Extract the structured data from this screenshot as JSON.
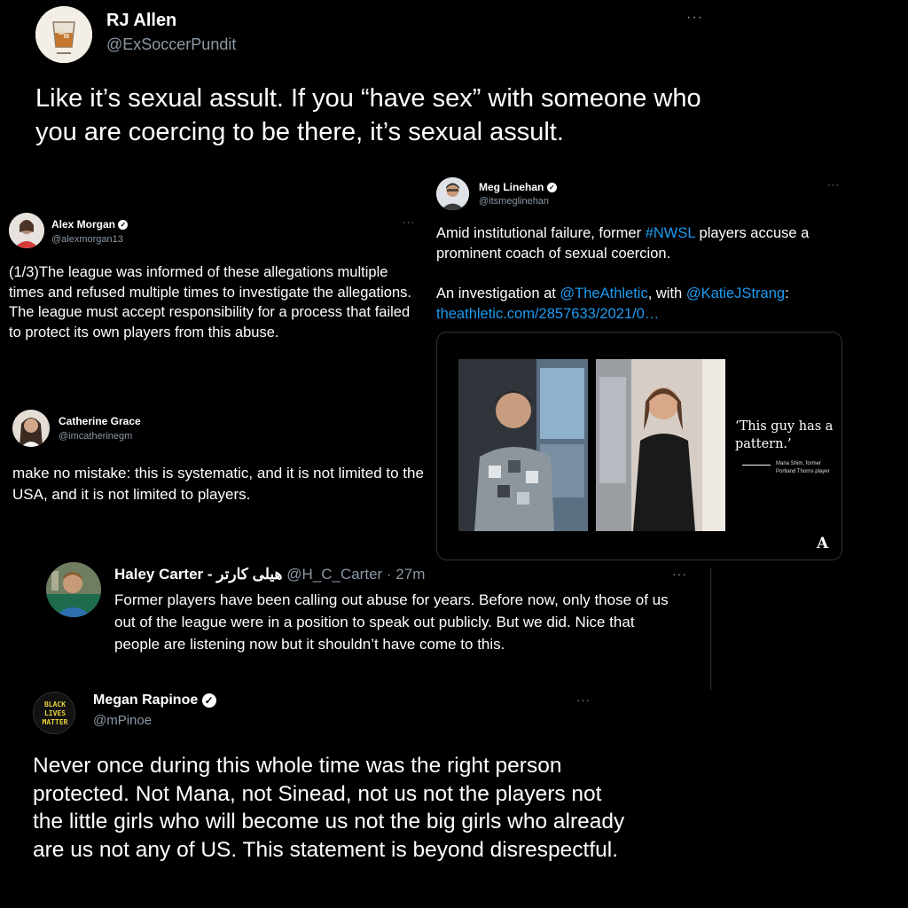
{
  "tweets": [
    {
      "name": "RJ Allen",
      "handle": "@ExSoccerPundit",
      "text": "Like it’s sexual assult. If you “have sex” with someone who you are coercing to be there, it’s sexual assult."
    },
    {
      "name": "Alex Morgan",
      "handle": "@alexmorgan13",
      "verified": true,
      "text": "(1/3)The league was informed of these allegations multiple times and refused multiple times to investigate the allegations. The league must accept responsibility for a process that failed to protect its own players from this abuse."
    },
    {
      "name": "Meg Linehan",
      "handle": "@itsmeglinehan",
      "verified": true,
      "text_1": "Amid institutional failure, former ",
      "hashtag": "#NWSL",
      "text_2": " players accuse a prominent coach of sexual coercion.",
      "text_3": "An investigation at ",
      "mention_1": "@TheAthletic",
      "text_4": ", with ",
      "mention_2": "@KatieJStrang",
      "text_5": ":",
      "link": "theathletic.com/2857633/2021/0…",
      "card": {
        "quote": "‘This guy has a pattern.’",
        "credit": "Mana Shim, former Portland Thorns player",
        "logo": "A"
      }
    },
    {
      "name": "Catherine Grace",
      "handle": "@imcatherinegm",
      "text": "make no mistake: this is systematic, and it is not limited to the USA, and it is not limited to players."
    },
    {
      "name": "Haley Carter - هيلى كارتر",
      "handle": "@H_C_Carter",
      "time": "· 27m",
      "text": "Former players have been calling out abuse for years. Before now, only those of us out of the league were in a position to speak out publicly. But we did. Nice that people are listening now but it shouldn’t have come to this."
    },
    {
      "name": "Megan Rapinoe",
      "handle": "@mPinoe",
      "verified": true,
      "avatar_text": "BLACK LIVES MATTER",
      "text": "Never once during this whole time was the right person protected. Not Mana, not Sinead, not us not the players not the little girls who will become us not the big girls who already are us not any of US. This statement is beyond disrespectful."
    }
  ],
  "more_label": "···",
  "verified_glyph": "✓",
  "icons": [
    "more-icon",
    "verified-badge-icon"
  ],
  "colors": {
    "background": "#000000",
    "link": "#1d9bf0",
    "muted": "#8b98a5"
  }
}
